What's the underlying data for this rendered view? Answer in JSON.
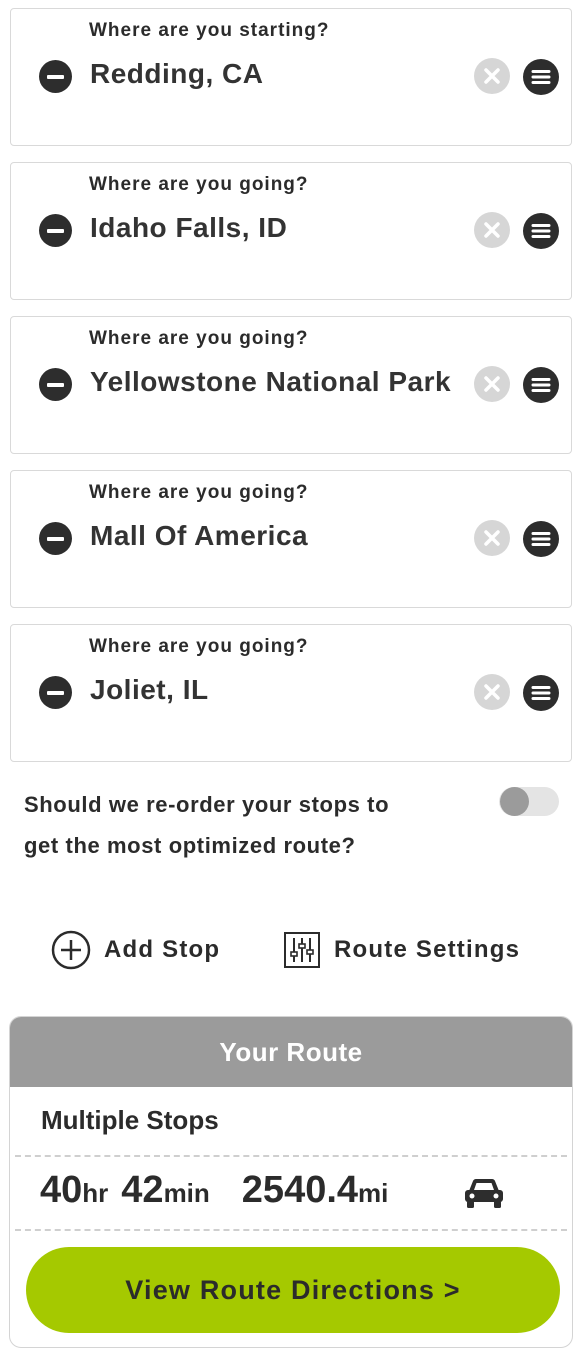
{
  "stops": [
    {
      "label": "Where are you starting?",
      "value": "Redding, CA"
    },
    {
      "label": "Where are you going?",
      "value": "Idaho Falls, ID"
    },
    {
      "label": "Where are you going?",
      "value": "Yellowstone National Park"
    },
    {
      "label": "Where are you going?",
      "value": "Mall Of America"
    },
    {
      "label": "Where are you going?",
      "value": "Joliet, IL"
    }
  ],
  "optimize": {
    "line1": "Should we re-order your stops to",
    "line2": "get the most optimized route?",
    "enabled": false
  },
  "actions": {
    "add_stop": "Add Stop",
    "route_settings": "Route Settings"
  },
  "route": {
    "header": "Your Route",
    "subtitle": "Multiple Stops",
    "hours": "40",
    "hours_unit": "hr",
    "minutes": "42",
    "minutes_unit": "min",
    "distance": "2540.4",
    "distance_unit": "mi",
    "vehicle_icon": "car-icon",
    "cta": "View Route Directions >"
  },
  "colors": {
    "accent": "#a5c900",
    "header_gray": "#9b9b9b",
    "dark": "#2d2d2d"
  }
}
